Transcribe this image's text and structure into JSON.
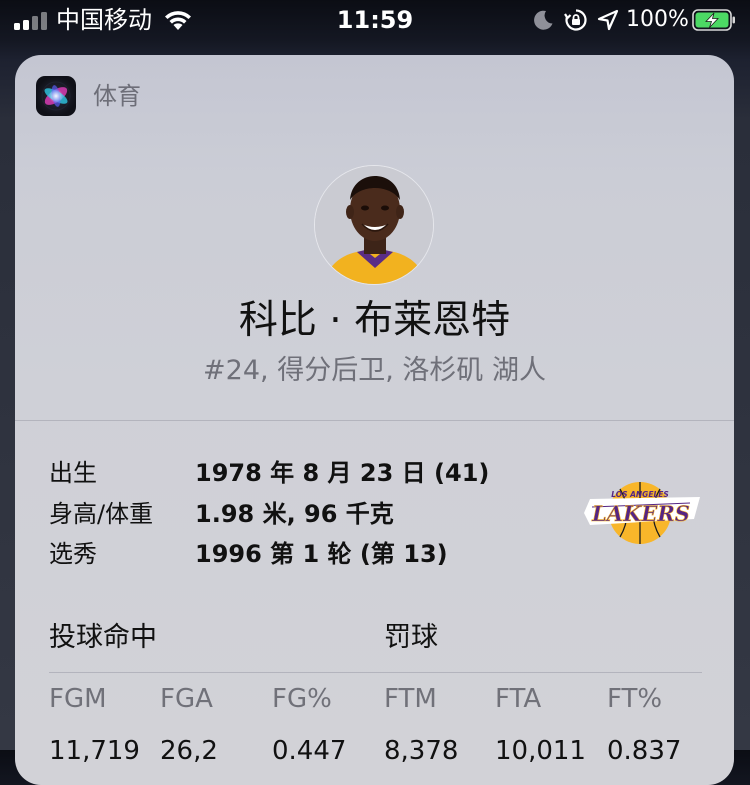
{
  "status_bar": {
    "carrier": "中国移动",
    "time": "11:59",
    "battery_percent": "100%"
  },
  "card": {
    "app_label": "体育",
    "player": {
      "name": "科比 · 布莱恩特",
      "subtitle": "#24, 得分后卫, 洛杉矶 湖人"
    },
    "info": [
      {
        "label": "出生",
        "value": "1978 年 8 月 23 日 (41)"
      },
      {
        "label": "身高/体重",
        "value": "1.98 米, 96 千克"
      },
      {
        "label": "选秀",
        "value": "1996 第 1 轮 (第 13)"
      }
    ],
    "team_logo_text": "LAKERS",
    "team_logo_subtext": "LOS ANGELES",
    "sections": {
      "field_goals": "投球命中",
      "free_throws": "罚球"
    },
    "stats": [
      {
        "header": "FGM",
        "value": "11,719"
      },
      {
        "header": "FGA",
        "value": "26,2"
      },
      {
        "header": "FG%",
        "value": "0.447"
      },
      {
        "header": "FTM",
        "value": "8,378"
      },
      {
        "header": "FTA",
        "value": "10,011"
      },
      {
        "header": "FT%",
        "value": "0.837"
      }
    ]
  },
  "colors": {
    "card_bg": "#cfd0d7",
    "text_primary": "#111111",
    "text_secondary": "#6f7079",
    "lakers_purple": "#552583",
    "lakers_gold": "#fdb927",
    "battery_green": "#4cd964"
  },
  "icons": [
    "signal-icon",
    "wifi-icon",
    "moon-icon",
    "orientation-lock-icon",
    "location-icon",
    "battery-charging-icon",
    "siri-icon"
  ]
}
